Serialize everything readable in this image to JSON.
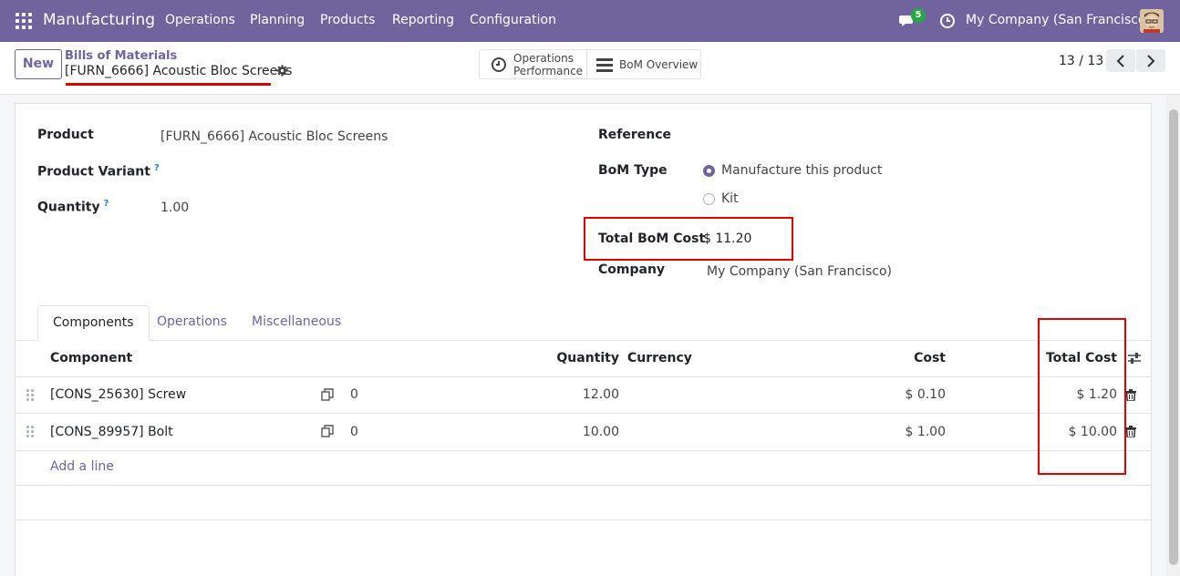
{
  "navbar": {
    "app_name": "Manufacturing",
    "menus": [
      "Operations",
      "Planning",
      "Products",
      "Reporting",
      "Configuration"
    ],
    "chat_count": "5",
    "company": "My Company (San Francisco)",
    "icons": {
      "apps": "apps-grid-icon",
      "chat": "chat-icon",
      "activity": "clock-icon",
      "user": "avatar"
    }
  },
  "control": {
    "new_label": "New",
    "breadcrumb": "Bills of Materials",
    "record_name": "[FURN_6666] Acoustic Bloc Screens",
    "smart_buttons": {
      "operations_line1": "Operations",
      "operations_line2": "Performance",
      "bom_overview": "BoM Overview"
    },
    "pager": "13 / 13"
  },
  "form": {
    "product_label": "Product",
    "product_value": "[FURN_6666] Acoustic Bloc Screens",
    "variant_label": "Product Variant",
    "quantity_label": "Quantity",
    "quantity_value": "1.00",
    "help_mark": "?",
    "reference_label": "Reference",
    "bom_type_label": "BoM Type",
    "bom_type_options": [
      "Manufacture this product",
      "Kit"
    ],
    "bom_type_selected": "Manufacture this product",
    "total_cost_label": "Total BoM Cost",
    "total_cost_value": "$ 11.20",
    "company_label": "Company",
    "company_value": "My Company (San Francisco)"
  },
  "tabs": [
    "Components",
    "Operations",
    "Miscellaneous"
  ],
  "active_tab": "Components",
  "table": {
    "headers": {
      "component": "Component",
      "quantity": "Quantity",
      "currency": "Currency",
      "cost": "Cost",
      "total_cost": "Total Cost"
    },
    "rows": [
      {
        "component": "[CONS_25630] Screw",
        "count": "0",
        "quantity": "12.00",
        "cost": "$ 0.10",
        "total_cost": "$ 1.20"
      },
      {
        "component": "[CONS_89957] Bolt",
        "count": "0",
        "quantity": "10.00",
        "cost": "$ 1.00",
        "total_cost": "$ 10.00"
      }
    ],
    "add_line": "Add a line"
  },
  "colors": {
    "brand": "#71639e",
    "highlight": "#e00000",
    "badge": "#28a745"
  }
}
